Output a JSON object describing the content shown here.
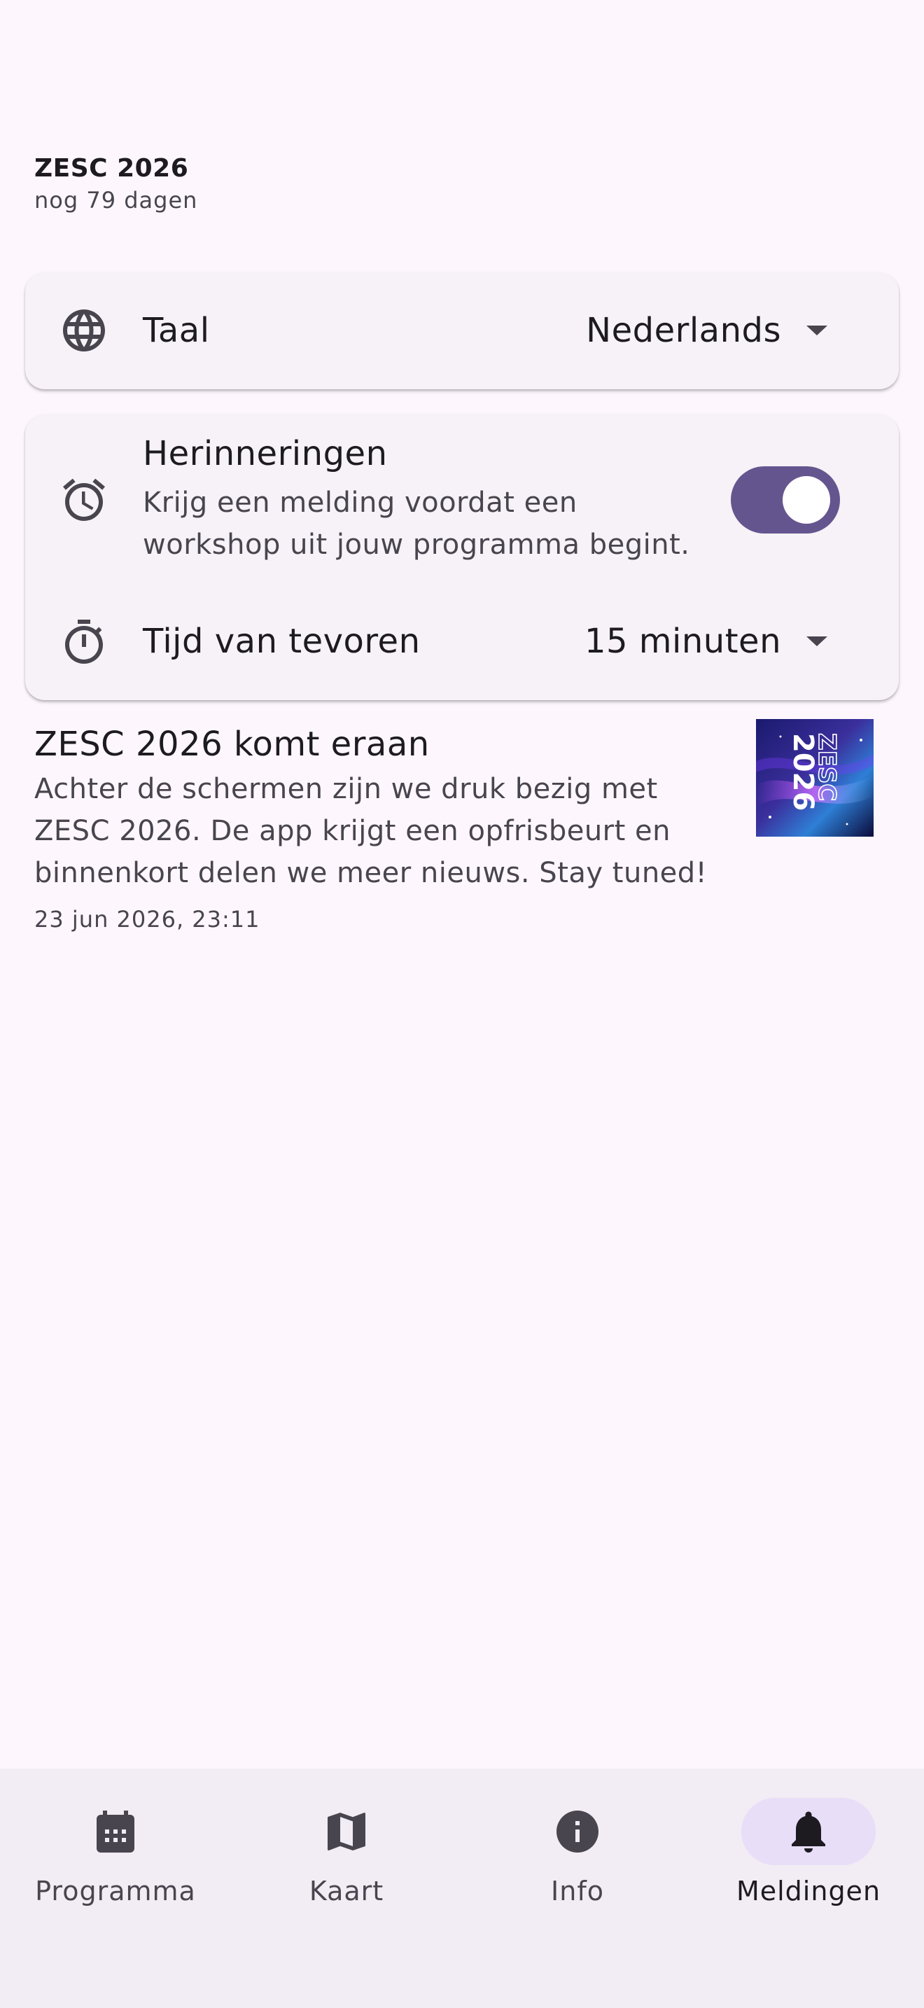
{
  "header": {
    "title": "ZESC 2026",
    "subtitle": "nog 79 dagen"
  },
  "language": {
    "label": "Taal",
    "value": "Nederlands",
    "icon": "globe-icon"
  },
  "reminders": {
    "title": "Herinneringen",
    "description": "Krijg een melding voordat een workshop uit jouw programma begint.",
    "enabled": true,
    "icon": "alarm-icon",
    "lead_time_label": "Tijd van tevoren",
    "lead_time_value": "15 minuten",
    "lead_time_icon": "timer-icon"
  },
  "notifications": [
    {
      "title": "ZESC 2026 komt eraan",
      "body": "Achter de schermen zijn we druk bezig met ZESC 2026. De app krijgt een opfrisbeurt en binnenkort delen we meer nieuws. Stay tuned!",
      "date": "23 jun 2026, 23:11",
      "image_text": "ZESC 2026"
    }
  ],
  "nav": {
    "items": [
      {
        "label": "Programma",
        "icon": "calendar-icon",
        "active": false
      },
      {
        "label": "Kaart",
        "icon": "map-icon",
        "active": false
      },
      {
        "label": "Info",
        "icon": "info-icon",
        "active": false
      },
      {
        "label": "Meldingen",
        "icon": "bell-icon",
        "active": true
      }
    ]
  },
  "colors": {
    "background": "#fdf7fd",
    "card": "#f6f2f7",
    "accent": "#65558f",
    "nav_background": "#f2ecf4",
    "nav_indicator": "#e8def8",
    "text_primary": "#1d1b20",
    "text_secondary": "#49454f"
  }
}
